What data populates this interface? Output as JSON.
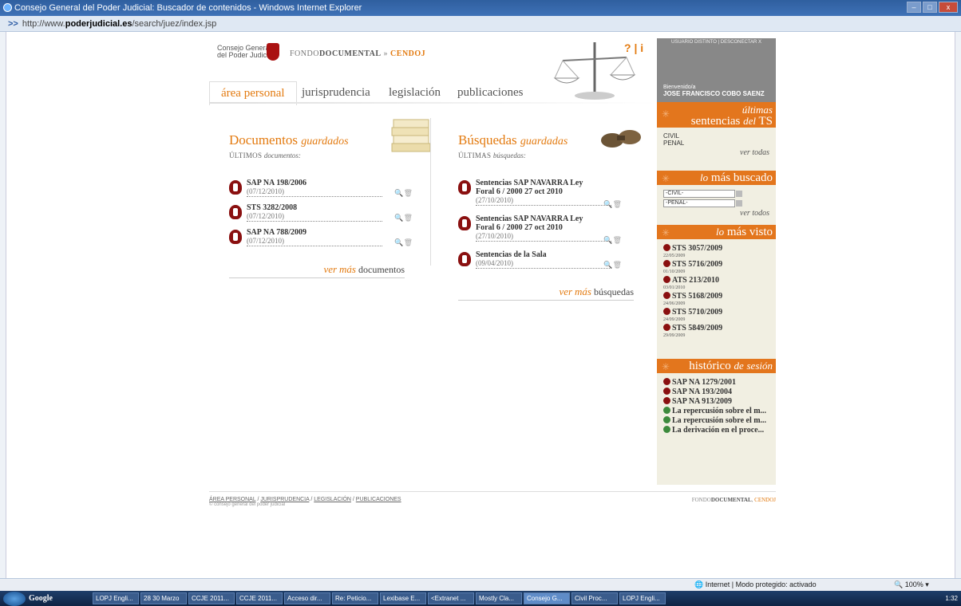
{
  "window": {
    "title": "Consejo General del Poder Judicial: Buscador de contenidos - Windows Internet Explorer",
    "url_prefix": "http://www.",
    "url_domain": "poderjudicial.es",
    "url_path": "/search/juez/index.jsp"
  },
  "header": {
    "logo_line1": "Consejo General",
    "logo_line2": "del Poder Judicial",
    "fondo": "FONDO",
    "documental": "DOCUMENTAL",
    "sep": " » ",
    "cendoj": "CENDOJ",
    "help": "?",
    "info": "i",
    "user_links": "USUARIO DISTINTO | DESCONECTAR X",
    "welcome": "Bienvenido/a",
    "username": "JOSE FRANCISCO COBO SAENZ"
  },
  "tabs": [
    {
      "label": "área personal"
    },
    {
      "label": "jurisprudencia"
    },
    {
      "label": "legislación"
    },
    {
      "label": "publicaciones"
    }
  ],
  "documents": {
    "title": "Documentos",
    "title_italic": "guardados",
    "sub": "ÚLTIMOS",
    "sub_italic": "documentos:",
    "items": [
      {
        "title": "SAP NA 198/2006",
        "date": "(07/12/2010)"
      },
      {
        "title": "STS 3282/2008",
        "date": "(07/12/2010)"
      },
      {
        "title": "SAP NA 788/2009",
        "date": "(07/12/2010)"
      }
    ],
    "more_prefix": "ver",
    "more_italic": "más",
    "more_suffix": "documentos"
  },
  "searches": {
    "title": "Búsquedas",
    "title_italic": "guardadas",
    "sub": "ÚLTIMAS",
    "sub_italic": "búsquedas:",
    "items": [
      {
        "line1": "Sentencias SAP NAVARRA Ley",
        "line2": "Foral 6 / 2000 27 oct 2010",
        "date": "(27/10/2010)"
      },
      {
        "line1": "Sentencias SAP NAVARRA Ley",
        "line2": "Foral 6 / 2000 27 oct 2010",
        "date": "(27/10/2010)"
      },
      {
        "line1": "Sentencias de la Sala",
        "line2": "",
        "date": "(09/04/2010)"
      }
    ],
    "more_prefix": "ver",
    "more_italic": "más",
    "more_suffix": "búsquedas"
  },
  "sidebar": {
    "ultimas": {
      "line1": "últimas",
      "line2a": "sentencias",
      "line2b": "del",
      "line2c": "TS",
      "items": [
        "CIVIL",
        "PENAL"
      ],
      "more": "ver todas"
    },
    "buscado": {
      "a": "lo",
      "b": "más",
      "c": "buscado",
      "options": [
        "-CIVIL-",
        "-PENAL-"
      ],
      "more": "ver todos"
    },
    "visto": {
      "a": "lo",
      "b": "más",
      "c": "visto",
      "items": [
        {
          "title": "STS 3057/2009",
          "date": "22/05/2009"
        },
        {
          "title": "STS 5716/2009",
          "date": "01/10/2009"
        },
        {
          "title": "ATS 213/2010",
          "date": "03/01/2010"
        },
        {
          "title": "STS 5168/2009",
          "date": "24/06/2009"
        },
        {
          "title": "STS 5710/2009",
          "date": "24/09/2009"
        },
        {
          "title": "STS 5849/2009",
          "date": "29/09/2009"
        }
      ]
    },
    "historico": {
      "a": "histórico",
      "b": "de",
      "c": "sesión",
      "items": [
        {
          "title": "SAP NA 1279/2001",
          "type": "doc"
        },
        {
          "title": "SAP NA 193/2004",
          "type": "doc"
        },
        {
          "title": "SAP NA 913/2009",
          "type": "doc"
        },
        {
          "title": "La repercusión sobre el m...",
          "type": "pub"
        },
        {
          "title": "La repercusión sobre el m...",
          "type": "pub"
        },
        {
          "title": "La derivación en el proce...",
          "type": "pub"
        }
      ]
    }
  },
  "footer": {
    "link1": "ÁREA PERSONAL",
    "link2": "JURISPRUDENCIA",
    "link3": "LEGISLACIÓN",
    "link4": "PUBLICACIONES",
    "copy": "© consejo general del poder judicial",
    "right_a": "FONDO",
    "right_b": "DOCUMENTAL",
    "right_c": "CENDOJ"
  },
  "statusbar": {
    "zone": "Internet | Modo protegido: activado",
    "zoom": "100%"
  },
  "taskbar": {
    "google": "Google",
    "items": [
      "LOPJ Engli...",
      "28 30 Marzo",
      "CCJE 2011...",
      "CCJE 2011...",
      "Acceso dir...",
      "Re: Peticio...",
      "Lexibase E...",
      "<Extranet ...",
      "Mostly Cla...",
      "Consejo G...",
      "Civil Proc...",
      "LOPJ Engli..."
    ],
    "clock": "1:32"
  }
}
